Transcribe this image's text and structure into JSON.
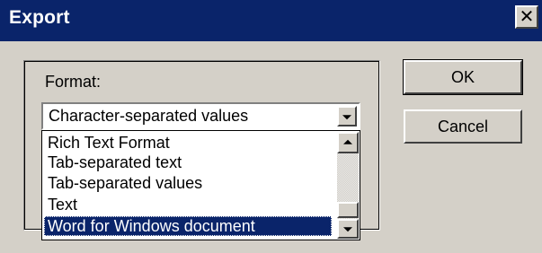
{
  "window": {
    "title": "Export",
    "close_glyph": "✕",
    "close_icon": "close-icon"
  },
  "format": {
    "label": "Format:",
    "selected_value": "Character-separated values",
    "options_visible": [
      "Rich Text Format",
      "Tab-separated text",
      "Tab-separated values",
      "Text",
      "Word for Windows document"
    ],
    "highlighted_option": "Word for Windows document"
  },
  "buttons": {
    "ok_label": "OK",
    "cancel_label": "Cancel"
  },
  "colors": {
    "title_bar": "#0a246a",
    "face": "#d4d0c8",
    "selection": "#0a246a"
  }
}
